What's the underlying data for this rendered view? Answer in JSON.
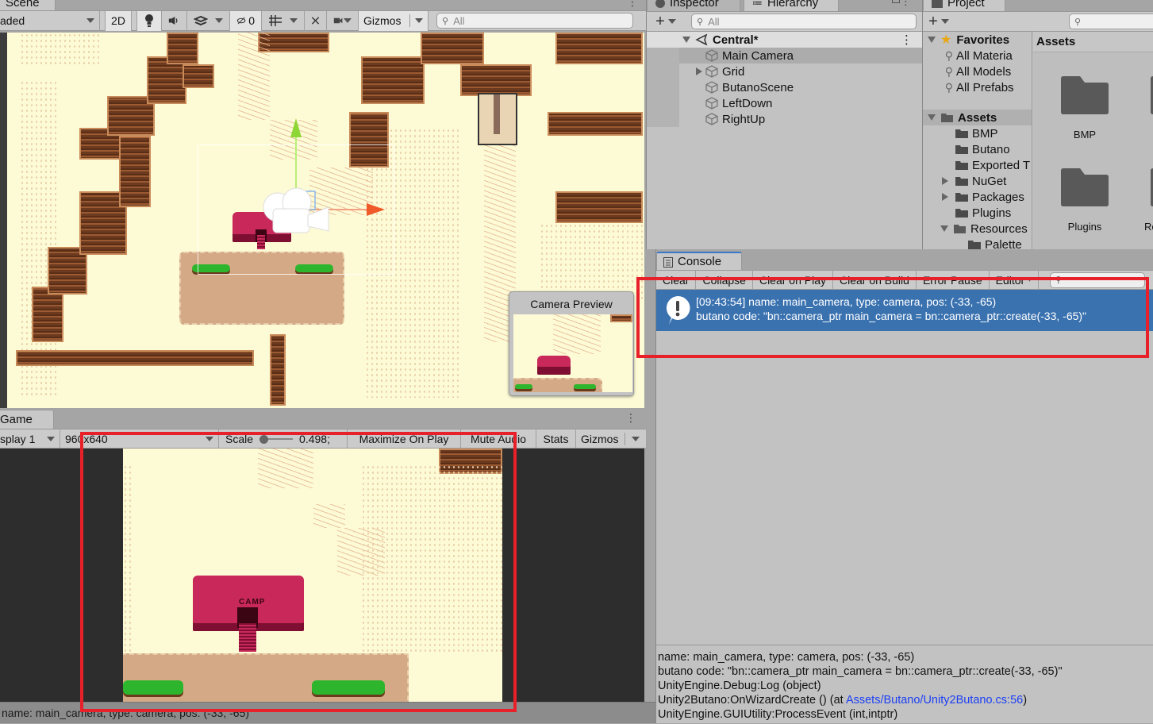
{
  "scene": {
    "tab_label": "Scene",
    "shading_mode": "aded",
    "btn_2d": "2D",
    "hidden_count": "0",
    "gizmos_label": "Gizmos",
    "search_placeholder": "All",
    "camera_preview_title": "Camera Preview"
  },
  "game": {
    "tab_label": "Game",
    "display": "splay 1",
    "resolution": "960x640",
    "scale_label": "Scale",
    "scale_value": "0.498;",
    "maximize_on_play": "Maximize On Play",
    "mute_audio": "Mute Audio",
    "stats": "Stats",
    "gizmos": "Gizmos",
    "status_text": "name: main_camera, type: camera, pos: (-33, -65)",
    "sprite_label": "CAMP"
  },
  "hierarchy": {
    "tabs": [
      {
        "label": "Inspector",
        "icon": "info-icon"
      },
      {
        "label": "Hierarchy",
        "icon": "list-icon"
      }
    ],
    "search_placeholder": "All",
    "scene_name": "Central*",
    "items": [
      {
        "label": "Main Camera",
        "selected": true,
        "expandable": false
      },
      {
        "label": "Grid",
        "selected": false,
        "expandable": true
      },
      {
        "label": "ButanoScene",
        "selected": false,
        "expandable": false
      },
      {
        "label": "LeftDown",
        "selected": false,
        "expandable": false
      },
      {
        "label": "RightUp",
        "selected": false,
        "expandable": false
      }
    ]
  },
  "project": {
    "tab_label": "Project",
    "favorites_label": "Favorites",
    "favorites": [
      "All Materia",
      "All Models",
      "All Prefabs"
    ],
    "assets_label": "Assets",
    "asset_tree": [
      {
        "label": "BMP",
        "expandable": false,
        "expanded": false,
        "depth": 1
      },
      {
        "label": "Butano",
        "expandable": false,
        "expanded": false,
        "depth": 1
      },
      {
        "label": "Exported T",
        "expandable": false,
        "expanded": false,
        "depth": 1
      },
      {
        "label": "NuGet",
        "expandable": true,
        "expanded": false,
        "depth": 1
      },
      {
        "label": "Packages",
        "expandable": true,
        "expanded": false,
        "depth": 1
      },
      {
        "label": "Plugins",
        "expandable": false,
        "expanded": false,
        "depth": 1
      },
      {
        "label": "Resources",
        "expandable": true,
        "expanded": true,
        "depth": 1
      },
      {
        "label": "Palette",
        "expandable": false,
        "expanded": false,
        "depth": 2
      }
    ],
    "grid_header": "Assets",
    "grid_items": [
      "BMP",
      "Plugins",
      "Re"
    ]
  },
  "console": {
    "tab_label": "Console",
    "toolbar": [
      "Clear",
      "Collapse",
      "Clear on Play",
      "Clear on Build",
      "Error Pause",
      "Editor"
    ],
    "entry": {
      "line1": "[09:43:54] name: main_camera, type: camera, pos: (-33, -65)",
      "line2": "butano code: \"bn::camera_ptr main_camera = bn::camera_ptr::create(-33, -65)\""
    },
    "detail": {
      "line1": "name: main_camera, type: camera, pos: (-33, -65)",
      "line2": "butano code: \"bn::camera_ptr main_camera = bn::camera_ptr::create(-33, -65)\"",
      "line3": "UnityEngine.Debug:Log (object)",
      "line4_prefix": "Unity2Butano:OnWizardCreate () (at ",
      "line4_link": "Assets/Butano/Unity2Butano.cs:56",
      "line4_suffix": ")",
      "line5": "UnityEngine.GUIUtility:ProcessEvent (int,intptr)"
    }
  },
  "colors": {
    "highlight_box": "#e8202a",
    "selection_blue": "#3a72b0",
    "link_blue": "#1c3ff5",
    "scene_background": "#fdfbd6"
  }
}
